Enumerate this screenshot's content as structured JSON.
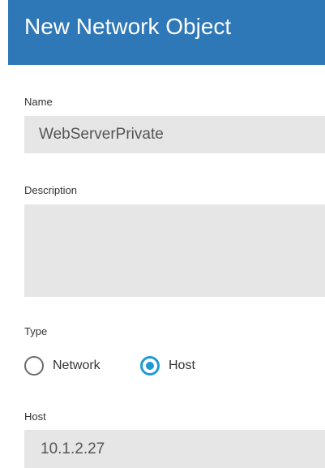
{
  "dialog": {
    "title": "New Network Object"
  },
  "form": {
    "name": {
      "label": "Name",
      "value": "WebServerPrivate"
    },
    "description": {
      "label": "Description",
      "value": ""
    },
    "type": {
      "label": "Type",
      "options": [
        {
          "label": "Network",
          "selected": false
        },
        {
          "label": "Host",
          "selected": true
        }
      ]
    },
    "host": {
      "label": "Host",
      "value": "10.1.2.27"
    }
  },
  "colors": {
    "header_bg": "#2f78b8",
    "header_text": "#ffffff",
    "field_bg": "#e6e6e6",
    "radio_selected": "#1e9bd7",
    "radio_unselected": "#6b6b6b"
  }
}
